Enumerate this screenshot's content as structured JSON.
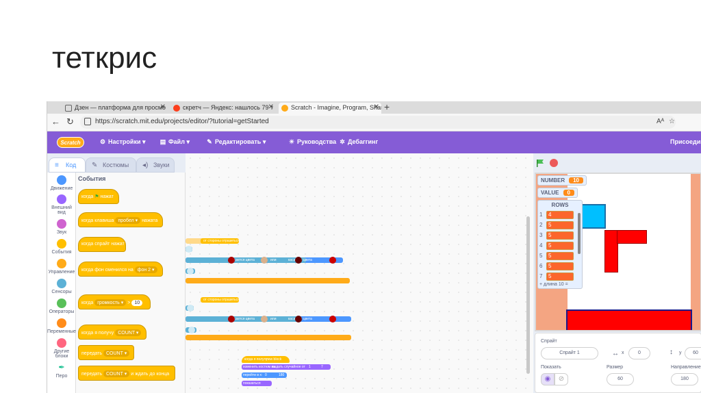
{
  "slide": {
    "title": "теткрис"
  },
  "browser": {
    "tabs": [
      {
        "label": "Дзен — платформа для просмо",
        "close": "✕",
        "icon": "tab-page-icon"
      },
      {
        "label": "скретч — Яндекс: нашлось 79 т",
        "close": "✕",
        "icon": "yandex-icon"
      },
      {
        "label": "Scratch - Imagine, Program, Shar",
        "close": "✕",
        "icon": "scratch-cat-icon"
      }
    ],
    "new_tab": "+",
    "url": "https://scratch.mit.edu/projects/editor/?tutorial=getStarted",
    "read_aloud": "Aᴬ",
    "favorite": "☆"
  },
  "menu": {
    "logo": "Scratch",
    "settings": "Настройки",
    "file": "Файл",
    "edit": "Редактировать",
    "tutorials": "Руководства",
    "debugging": "Дебаггинг",
    "join": "Присоедин"
  },
  "editor_tabs": {
    "code": "Код",
    "costumes": "Костюмы",
    "sounds": "Звуки"
  },
  "categories": [
    {
      "label": "Движение",
      "color": "#4c97ff"
    },
    {
      "label": "Внешний вид",
      "color": "#9966ff"
    },
    {
      "label": "Звук",
      "color": "#cf63cf"
    },
    {
      "label": "События",
      "color": "#ffbf00"
    },
    {
      "label": "Управление",
      "color": "#ffab19"
    },
    {
      "label": "Сенсоры",
      "color": "#5cb1d6"
    },
    {
      "label": "Операторы",
      "color": "#59c059"
    },
    {
      "label": "Переменные",
      "color": "#ff8c1a"
    },
    {
      "label": "Другие блоки",
      "color": "#ff6680"
    },
    {
      "label": "Перо",
      "color": "#0fbd8c"
    }
  ],
  "palette": {
    "title": "События",
    "blocks": {
      "flag_clicked": {
        "pre": "когда",
        "post": "нажат"
      },
      "key_pressed": {
        "pre": "когда клавиша",
        "key": "пробел",
        "post": "нажата"
      },
      "sprite_clicked": {
        "text": "когда спрайт нажат"
      },
      "backdrop_switch": {
        "pre": "когда фон сменился на",
        "backdrop": "фон 2"
      },
      "loudness": {
        "pre": "когда",
        "sensor": "громкость",
        "op": ">",
        "value": "10"
      },
      "receive": {
        "pre": "когда я получу",
        "msg": "COUNT"
      },
      "broadcast": {
        "pre": "передать",
        "msg": "COUNT"
      },
      "broadcast_wait": {
        "pre": "передать",
        "msg": "COUNT",
        "post": "и ждать до конца"
      }
    }
  },
  "script": {
    "s1_line1": "от стороны отразиться",
    "s1_line2": "повторять",
    "s1_cond_a": "касается цвета",
    "s1_cond_or": "или",
    "s1_cond_b": "касается цвета",
    "s2_line1": "от стороны отразиться",
    "s2_cond_a": "касается цвета",
    "s2_cond_or": "или",
    "s2_cond_b": "касается цвета",
    "s3_hat": "когда я получу",
    "s3_msg": "new block",
    "s3_costume": "изменить костюм на",
    "s3_random": "выдать случайное от",
    "s3_random_from": "1",
    "s3_random_to": "7",
    "s3_goto": "перейти в x:",
    "s3_x": "0",
    "s3_y": "180",
    "s3_show": "показаться"
  },
  "stage": {
    "monitors": [
      {
        "label": "NUMBER",
        "value": "10"
      },
      {
        "label": "VALUE",
        "value": "0"
      }
    ],
    "list": {
      "title": "ROWS",
      "items": [
        "4",
        "5",
        "5",
        "5",
        "5",
        "5",
        "5"
      ],
      "footer_add": "+",
      "footer_len": "длина 10",
      "footer_eq": "="
    }
  },
  "sprite_info": {
    "sprite_label": "Спрайт",
    "sprite_name": "Спрайт 1",
    "x_label": "x",
    "x_value": "0",
    "y_label": "y",
    "y_value": "60",
    "show_label": "Показать",
    "size_label": "Размер",
    "size_value": "60",
    "direction_label": "Направление",
    "direction_value": "180"
  },
  "colors": {
    "scratch_purple": "#855cd6",
    "events_yellow": "#ffbf00",
    "sensing_blue": "#5cb1d6",
    "tetris_red": "#ff0000",
    "tetris_cyan": "#00bfff",
    "wall_salmon": "#f4a582"
  }
}
